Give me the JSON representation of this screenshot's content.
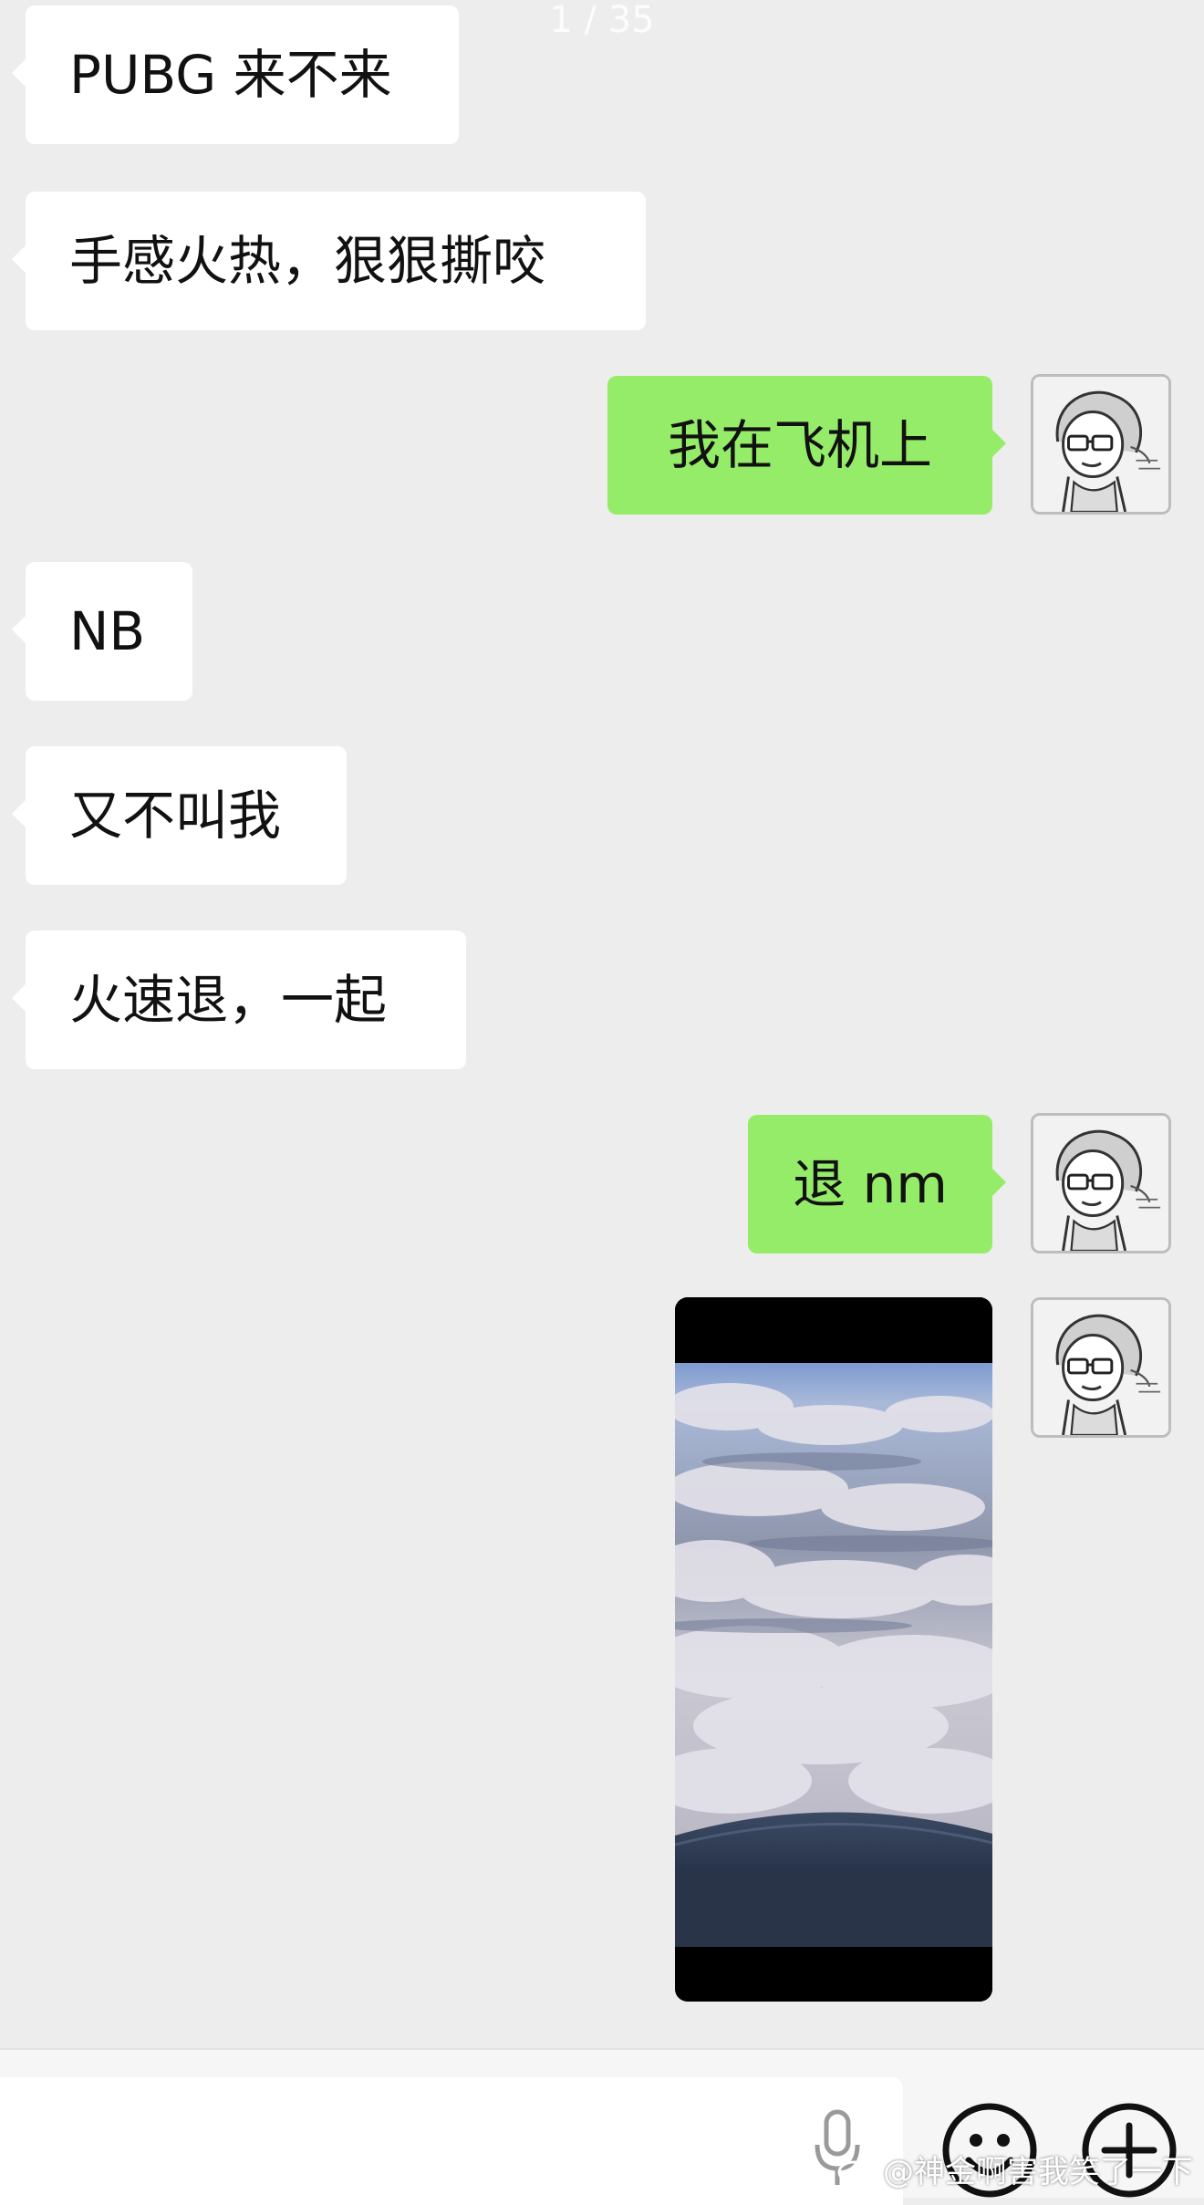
{
  "page_counter": "1 / 35",
  "messages": [
    {
      "side": "left",
      "text": "PUBG 来不来"
    },
    {
      "side": "left",
      "text": "手感火热，狠狠撕咬"
    },
    {
      "side": "right",
      "text": "我在飞机上"
    },
    {
      "side": "left",
      "text": "NB"
    },
    {
      "side": "left",
      "text": "又不叫我"
    },
    {
      "side": "left",
      "text": "火速退，一起"
    },
    {
      "side": "right",
      "text": "退 nm"
    },
    {
      "side": "right",
      "type": "video",
      "content": "airplane window view of clouds"
    }
  ],
  "input_bar": {
    "input_value": "",
    "icons": [
      "microphone-icon",
      "emoji-icon",
      "add-icon"
    ]
  },
  "watermark": {
    "text": "@神金啊害我笑了一下"
  },
  "colors": {
    "background": "#ededed",
    "left_bubble": "#ffffff",
    "right_bubble": "#95ec69"
  }
}
